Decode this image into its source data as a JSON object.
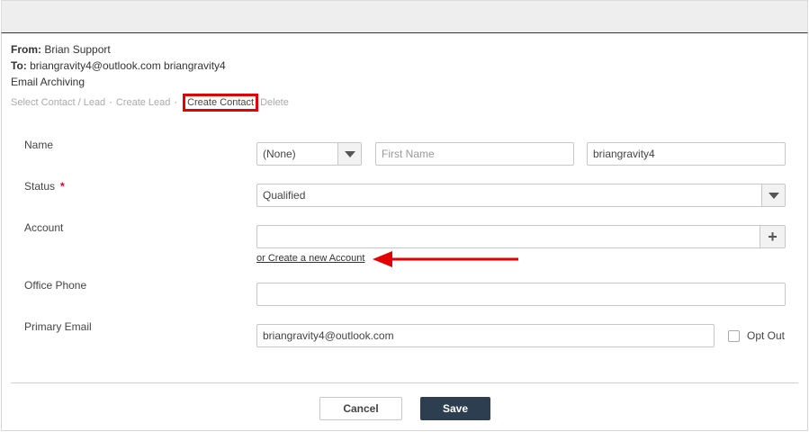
{
  "email": {
    "from_label": "From:",
    "from_value": "Brian Support",
    "to_label": "To:",
    "to_value": "briangravity4@outlook.com briangravity4",
    "subject": "Email Archiving"
  },
  "actions": {
    "select_contact": "Select Contact / Lead",
    "create_lead": "Create Lead",
    "create_contact": "Create Contact",
    "delete": "Delete",
    "separator": "·"
  },
  "form": {
    "name_label": "Name",
    "salutation_value": "(None)",
    "first_name_placeholder": "First Name",
    "first_name_value": "",
    "last_name_value": "briangravity4",
    "status_label": "Status",
    "status_required": "*",
    "status_value": "Qualified",
    "account_label": "Account",
    "account_value": "",
    "create_account_link": "or Create a new Account",
    "office_phone_label": "Office Phone",
    "office_phone_value": "",
    "primary_email_label": "Primary Email",
    "primary_email_value": "briangravity4@outlook.com",
    "opt_out_label": "Opt Out"
  },
  "buttons": {
    "cancel": "Cancel",
    "save": "Save"
  },
  "colors": {
    "highlight": "#e30000",
    "save_bg": "#2c3e50",
    "arrow": "#e30000"
  }
}
